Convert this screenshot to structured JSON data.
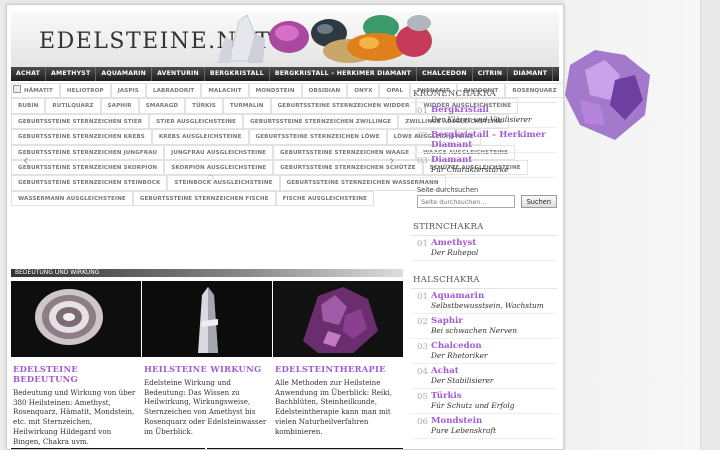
{
  "logo": {
    "initial": "E",
    "rest": "DELSTEINE.NET"
  },
  "nav": [
    "ACHAT",
    "AMETHYST",
    "AQUAMARIN",
    "AVENTURIN",
    "BERGKRISTALL",
    "BERGKRISTALL – HERKIMER DIAMANT",
    "CHALCEDON",
    "CITRIN",
    "DIAMANT"
  ],
  "tags": [
    [
      "HÄMATIT",
      "HELIOTROP",
      "JASPIS",
      "LABRADORIT",
      "MALACHIT",
      "MONDSTEIN",
      "OBSIDIAN",
      "ONYX",
      "OPAL",
      "PHENAKIT",
      "RHODONIT",
      "ROSENQUARZ"
    ],
    [
      "RUBIN",
      "RUTILQUARZ",
      "SAPHIR",
      "SMARAGD",
      "TÜRKIS",
      "TURMALIN",
      "GEBURTSSTEINE STERNZEICHEN WIDDER",
      "WIDDER AUSGLEICHSTEINE"
    ],
    [
      "GEBURTSSTEINE STERNZEICHEN STIER",
      "STIER AUSGLEICHSTEINE",
      "GEBURTSSTEINE STERNZEICHEN ZWILLINGE",
      "ZWILLINGE AUSGLEICHSTEINE"
    ],
    [
      "GEBURTSSTEINE STERNZEICHEN KREBS",
      "KREBS AUSGLEICHSTEINE",
      "GEBURTSSTEINE STERNZEICHEN LÖWE",
      "LÖWE AUSGLEICHSTEINE"
    ],
    [
      "GEBURTSSTEINE STERNZEICHEN JUNGFRAU",
      "JUNGFRAU AUSGLEICHSTEINE",
      "GEBURTSSTEINE STERNZEICHEN WAAGE",
      "WAAGE AUSGLEICHSTEINE"
    ],
    [
      "GEBURTSSTEINE STERNZEICHEN SKORPION",
      "SKORPION AUSGLEICHSTEINE",
      "GEBURTSSTEINE STERNZEICHEN SCHÜTZE",
      "SCHÜTZE AUSGLEICHSTEINE"
    ],
    [
      "GEBURTSSTEINE STERNZEICHEN STEINBOCK",
      "STEINBOCK AUSGLEICHSTEINE",
      "GEBURTSSTEINE STERNZEICHEN WASSERMANN"
    ],
    [
      "WASSERMANN AUSGLEICHSTEINE",
      "GEBURTSSTEINE STERNZEICHEN FISCHE",
      "FISCHE AUSGLEICHSTEINE"
    ]
  ],
  "section_bar": "BEDEUTUNG UND WIRKUNG",
  "cards": [
    {
      "title": "EDELSTEINE BEDEUTUNG",
      "text": "Bedeutung und Wirkung von über 380 Heilsteinen: Amethyst, Rosenquarz, Hämatit, Mondstein, etc. mit Sternzeichen, Heilwirkung Hildegard von Bingen, Chakra uvm."
    },
    {
      "title": "HEILSTEINE WIRKUNG",
      "text": "Edelsteine Wirkung und Bedeutung: Das Wissen zu Heilwirkung, Wirkungsweise, Sternzeichen von Amethyst bis Rosenquarz oder Edelsteinwasser im Überblick."
    },
    {
      "title": "EDELSTEINTHERAPIE",
      "text": "Alle Methoden zur Heilsteine Anwendung im Überblick: Reiki, Bachblüten, Steinheilkunde, Edelsteintherapie kann man mit vielen Naturheilverfahren kombinieren."
    }
  ],
  "sidebar": {
    "kronen": {
      "heading": "KRONENCHAKRA",
      "items": [
        {
          "num": "01",
          "name": "Bergkristall",
          "desc": "Der Klärer und Vitalisierer"
        },
        {
          "num": "02",
          "name": "Bergkristall – Herkimer Diamant",
          "desc": ""
        },
        {
          "num": "03",
          "name": "Diamant",
          "desc": "Für Charakterstärke"
        }
      ]
    },
    "search": {
      "label": "Seite durchsuchen",
      "placeholder": "Seite durchsuchen...",
      "button": "Suchen"
    },
    "stirn": {
      "heading": "STIRNCHAKRA",
      "items": [
        {
          "num": "01",
          "name": "Amethyst",
          "desc": "Der Ruhepol"
        }
      ]
    },
    "hals": {
      "heading": "HALSCHAKRA",
      "items": [
        {
          "num": "01",
          "name": "Aquamarin",
          "desc": "Selbstbewusstsein, Wachstum"
        },
        {
          "num": "02",
          "name": "Saphir",
          "desc": "Bei schwachen Nerven"
        },
        {
          "num": "03",
          "name": "Chalcedon",
          "desc": "Der Rhetoriker"
        },
        {
          "num": "04",
          "name": "Achat",
          "desc": "Der Stabilisierer"
        },
        {
          "num": "05",
          "name": "Türkis",
          "desc": "Für Schutz und Erfolg"
        },
        {
          "num": "06",
          "name": "Mondstein",
          "desc": "Pure Lebenskraft"
        }
      ]
    }
  },
  "colors": {
    "accent": "#a15ad2",
    "nav": "#1c1c1c"
  }
}
